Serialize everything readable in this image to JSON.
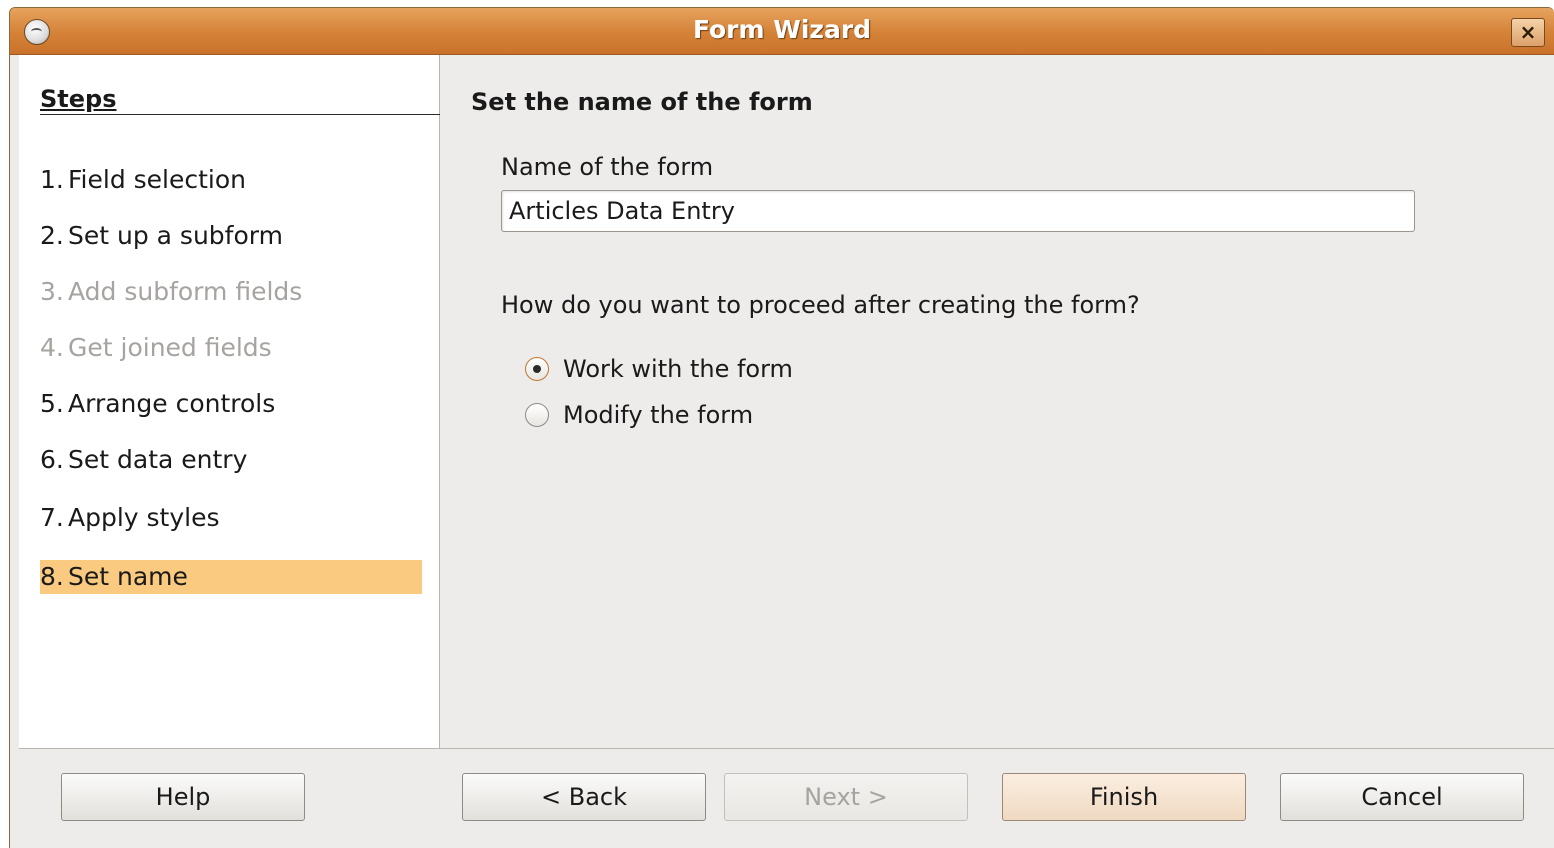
{
  "window": {
    "title": "Form Wizard",
    "close_glyph": "×",
    "accent_color": "#d6843a"
  },
  "sidebar": {
    "header": "Steps",
    "items": [
      {
        "num": "1.",
        "label": "Field selection",
        "state": "enabled"
      },
      {
        "num": "2.",
        "label": "Set up a subform",
        "state": "enabled"
      },
      {
        "num": "3.",
        "label": "Add subform fields",
        "state": "disabled"
      },
      {
        "num": "4.",
        "label": "Get joined fields",
        "state": "disabled"
      },
      {
        "num": "5.",
        "label": "Arrange controls",
        "state": "enabled"
      },
      {
        "num": "6.",
        "label": "Set data entry",
        "state": "enabled"
      },
      {
        "num": "7.",
        "label": "Apply styles",
        "state": "enabled"
      },
      {
        "num": "8.",
        "label": "Set name",
        "state": "active"
      }
    ],
    "active_color": "#f9ca7f"
  },
  "main": {
    "section_title": "Set the name of the form",
    "name_label": "Name of the form",
    "name_value": "Articles Data Entry",
    "proceed_question": "How do you want to proceed after creating the form?",
    "options": [
      {
        "label": "Work with the form",
        "checked": true
      },
      {
        "label": "Modify the form",
        "checked": false
      }
    ]
  },
  "buttons": {
    "help": "Help",
    "back": "< Back",
    "next": "Next >",
    "finish": "Finish",
    "cancel": "Cancel"
  }
}
